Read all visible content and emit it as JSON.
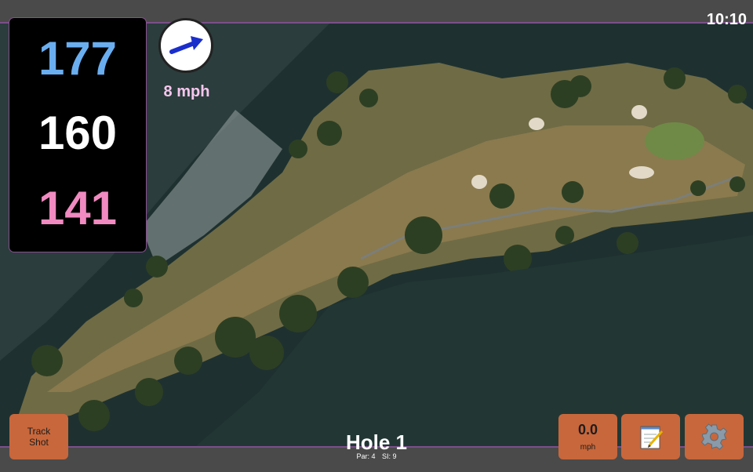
{
  "status": {
    "time": "10:10"
  },
  "distances": {
    "back": "177",
    "middle": "160",
    "front": "141"
  },
  "wind": {
    "speed_label": "8 mph"
  },
  "track_shot": {
    "line1": "Track",
    "line2": "Shot"
  },
  "speedometer": {
    "value": "0.0",
    "unit": "mph"
  },
  "hole": {
    "title": "Hole 1",
    "par": "Par: 4",
    "si": "SI: 9"
  },
  "icons": {
    "wind": "wind-arrow-icon",
    "notes": "notepad-icon",
    "settings": "gear-icon"
  },
  "colors": {
    "back_distance": "#6aaef0",
    "middle_distance": "#ffffff",
    "front_distance": "#f08ac0",
    "accent_border": "#7b4f8a",
    "tile": "#c8673b",
    "wind_label": "#f6c6ee"
  }
}
